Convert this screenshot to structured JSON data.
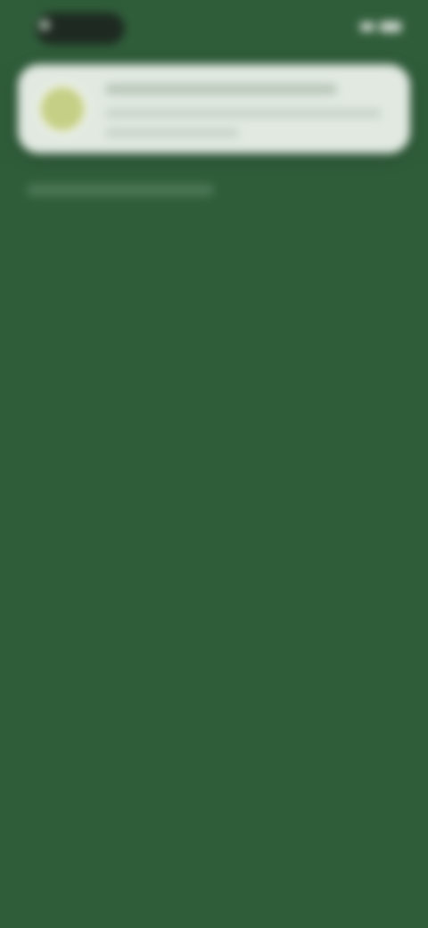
{
  "status_bar": {
    "icons": [
      "signal-icon",
      "wifi-icon",
      "battery-icon"
    ]
  },
  "notification": {
    "icon": "app-icon",
    "text": ""
  },
  "headline": "",
  "subtext": "",
  "colors": {
    "background": "#2f5d3a",
    "card": "#e1e9e1",
    "app_icon": "#c5cf85"
  }
}
